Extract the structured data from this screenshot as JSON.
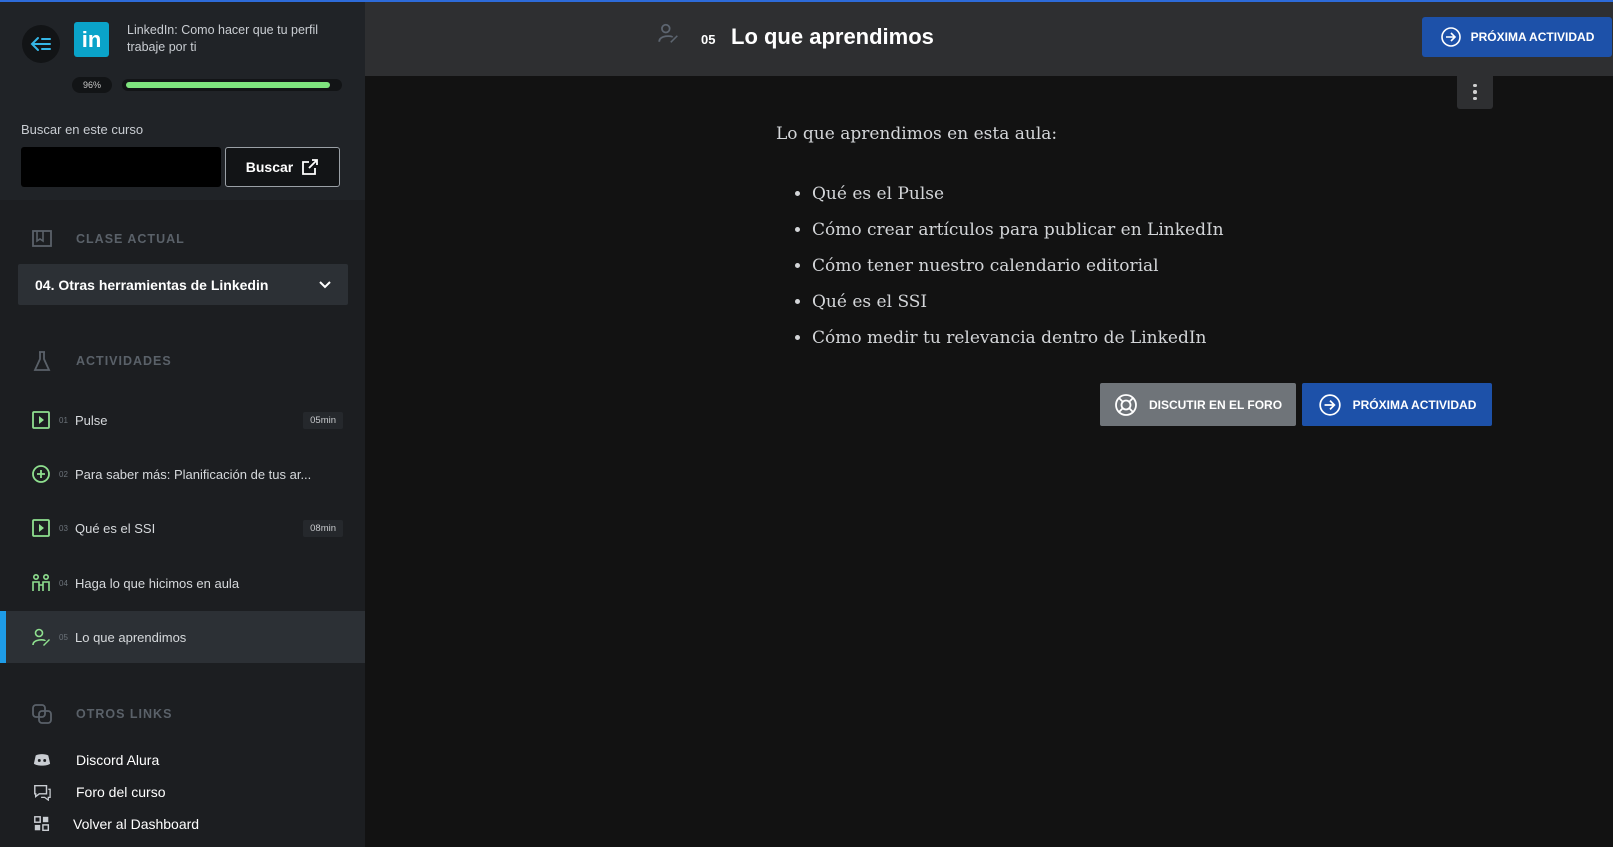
{
  "course": {
    "title": "LinkedIn: Como hacer que tu perfil trabaje por ti",
    "logo_text": "in",
    "progress_label": "96%",
    "progress": 0.96
  },
  "search": {
    "label": "Buscar en este curso",
    "placeholder": "",
    "button": "Buscar"
  },
  "current_class": {
    "heading": "CLASE ACTUAL",
    "selected": "04. Otras herramientas de Linkedin"
  },
  "activities": {
    "heading": "ACTIVIDADES",
    "items": [
      {
        "num": "01",
        "label": "Pulse",
        "duration": "05min",
        "icon": "video-icon"
      },
      {
        "num": "02",
        "label": "Para saber más: Planificación de tus ar...",
        "duration": "",
        "icon": "plus-circle-icon"
      },
      {
        "num": "03",
        "label": "Qué es el SSI",
        "duration": "08min",
        "icon": "video-icon"
      },
      {
        "num": "04",
        "label": "Haga lo que hicimos en aula",
        "duration": "",
        "icon": "practice-icon"
      },
      {
        "num": "05",
        "label": "Lo que aprendimos",
        "duration": "",
        "icon": "user-edit-icon"
      }
    ]
  },
  "other_links": {
    "heading": "OTROS LINKS",
    "items": [
      {
        "label": "Discord Alura",
        "icon": "discord-icon"
      },
      {
        "label": "Foro del curso",
        "icon": "forum-icon"
      },
      {
        "label": "Volver al Dashboard",
        "icon": "dashboard-icon"
      }
    ]
  },
  "header": {
    "number": "05",
    "title": "Lo que aprendimos",
    "next_button": "PRÓXIMA ACTIVIDAD"
  },
  "content": {
    "intro": "Lo que aprendimos en esta aula:",
    "bullets": [
      "Qué es el Pulse",
      "Cómo crear artículos para publicar en LinkedIn",
      "Cómo tener nuestro calendario editorial",
      "Qué es el SSI",
      "Cómo medir tu relevancia dentro de LinkedIn"
    ]
  },
  "actions": {
    "forum_button": "DISCUTIR EN EL FORO",
    "next_button": "PRÓXIMA ACTIVIDAD"
  },
  "colors": {
    "accent_blue": "#1d51a9",
    "active_bar": "#1e9ce8",
    "progress_green": "#7ee37e",
    "icon_green": "#8fe08f"
  }
}
